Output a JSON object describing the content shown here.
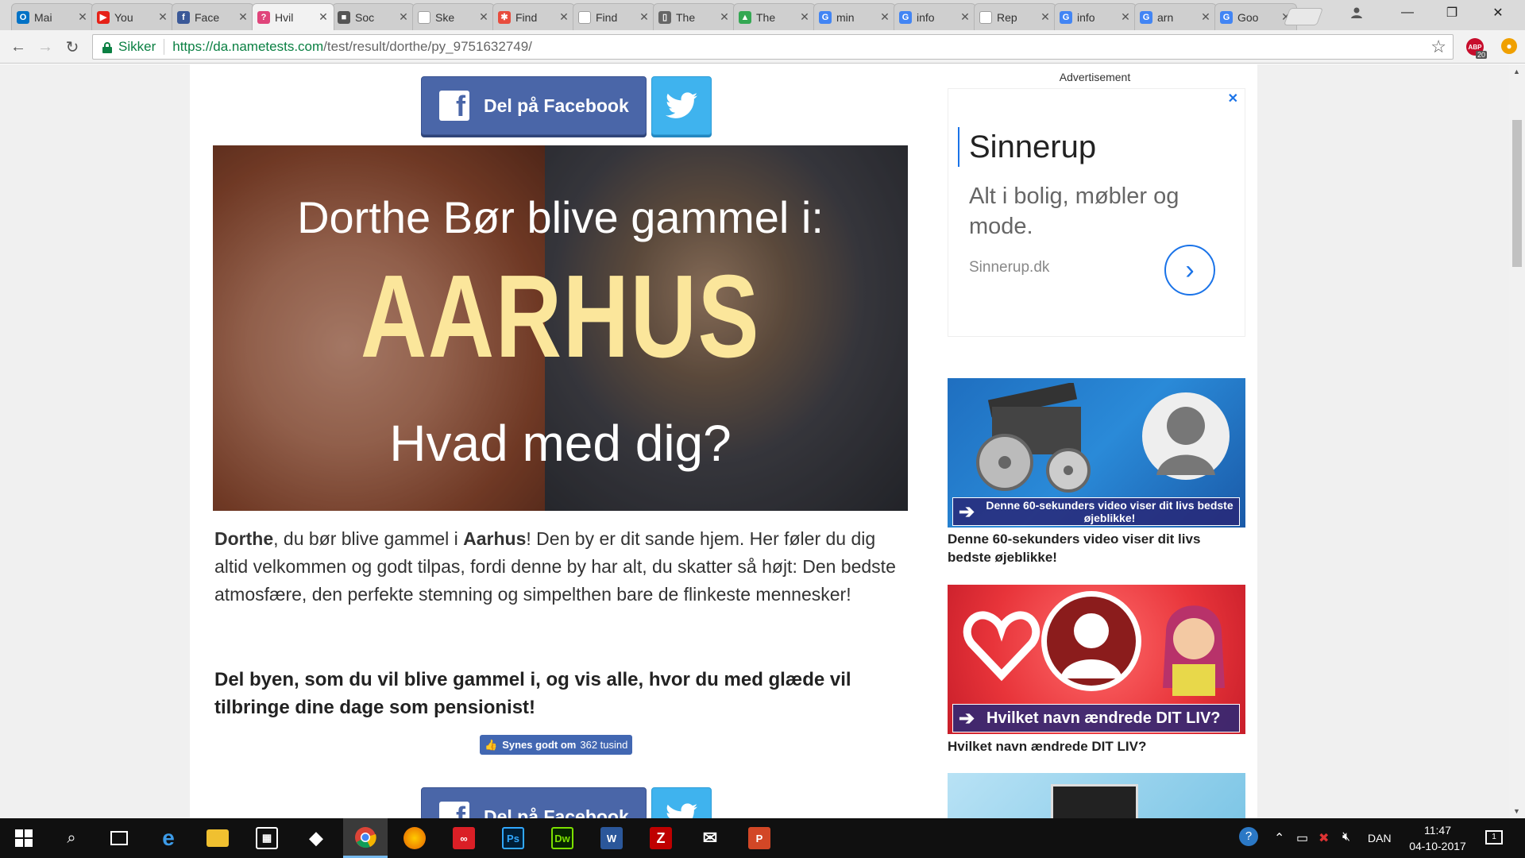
{
  "browser": {
    "tabs": [
      {
        "label": "Mai",
        "icon": "outlook-icon",
        "color": "#0072c6",
        "glyph": "O"
      },
      {
        "label": "You",
        "icon": "youtube-icon",
        "color": "#e62117",
        "glyph": "▶"
      },
      {
        "label": "Face",
        "icon": "facebook-icon",
        "color": "#3b5998",
        "glyph": "f"
      },
      {
        "label": "Hvil",
        "icon": "nametests-icon",
        "color": "#e0457b",
        "glyph": "?"
      },
      {
        "label": "Soc",
        "icon": "social-icon",
        "color": "#555555",
        "glyph": "■"
      },
      {
        "label": "Ske",
        "icon": "page-icon",
        "color": "#9e9e9e",
        "glyph": ""
      },
      {
        "label": "Find",
        "icon": "find-icon",
        "color": "#e84c3d",
        "glyph": "✱"
      },
      {
        "label": "Find",
        "icon": "page-icon",
        "color": "#9e9e9e",
        "glyph": ""
      },
      {
        "label": "The",
        "icon": "trello-icon",
        "color": "#666666",
        "glyph": "▯"
      },
      {
        "label": "The",
        "icon": "drive-icon",
        "color": "#34a853",
        "glyph": "▲"
      },
      {
        "label": "min",
        "icon": "google-icon",
        "color": "#4285f4",
        "glyph": "G"
      },
      {
        "label": "info",
        "icon": "google-icon",
        "color": "#4285f4",
        "glyph": "G"
      },
      {
        "label": "Rep",
        "icon": "page-icon",
        "color": "#9e9e9e",
        "glyph": ""
      },
      {
        "label": "info",
        "icon": "google-icon",
        "color": "#4285f4",
        "glyph": "G"
      },
      {
        "label": "arn",
        "icon": "google-icon",
        "color": "#4285f4",
        "glyph": "G"
      },
      {
        "label": "Goo",
        "icon": "google-translate-icon",
        "color": "#4285f4",
        "glyph": "G"
      }
    ],
    "secure_label": "Sikker",
    "url_host": "https://da.nametests.com",
    "url_path": "/test/result/dorthe/py_9751632749/",
    "abp_label": "ABP",
    "abp_count": "20"
  },
  "page": {
    "share_facebook_label": "Del på Facebook",
    "hero": {
      "line1": "Dorthe Bør blive gammel i:",
      "line2": "AARHUS",
      "line3": "Hvad med dig?"
    },
    "result": {
      "name": "Dorthe",
      "part1": ", du bør blive gammel i ",
      "city": "Aarhus",
      "part2": "! Den by er dit sande hjem. Her føler du dig altid velkommen og godt tilpas, fordi denne by har alt, du skatter så højt: Den bedste atmosfære, den perfekte stemning og simpelthen bare de flinkeste mennesker!"
    },
    "share_text": "Del byen, som du vil blive gammel i, og vis alle, hvor du med glæde vil tilbringe dine dage som pensionist!",
    "like": {
      "label": "Synes godt om",
      "count": "362 tusind"
    }
  },
  "sidebar": {
    "ad_label": "Advertisement",
    "ad": {
      "title": "Sinnerup",
      "description": "Alt i bolig, møbler og mode.",
      "domain": "Sinnerup.dk"
    },
    "promos": [
      {
        "banner": "Denne 60-sekunders video viser dit livs bedste øjeblikke!",
        "caption": "Denne 60-sekunders video viser dit livs bedste øjeblikke!"
      },
      {
        "banner": "Hvilket navn ændrede DIT LIV?",
        "caption": "Hvilket navn ændrede DIT LIV?"
      }
    ]
  },
  "taskbar": {
    "apps": [
      "start",
      "search",
      "task-view",
      "edge",
      "file-explorer",
      "store",
      "dropbox",
      "chrome",
      "firefox",
      "creative-cloud",
      "photoshop",
      "dreamweaver",
      "word",
      "filezilla",
      "mail",
      "powerpoint"
    ],
    "language": "DAN",
    "time": "11:47",
    "date": "04-10-2017",
    "notification_count": "1"
  },
  "colors": {
    "facebook": "#4a66a8",
    "twitter": "#3fb3ee",
    "secure_green": "#0b8043",
    "hero_accent": "#fbe69b"
  }
}
